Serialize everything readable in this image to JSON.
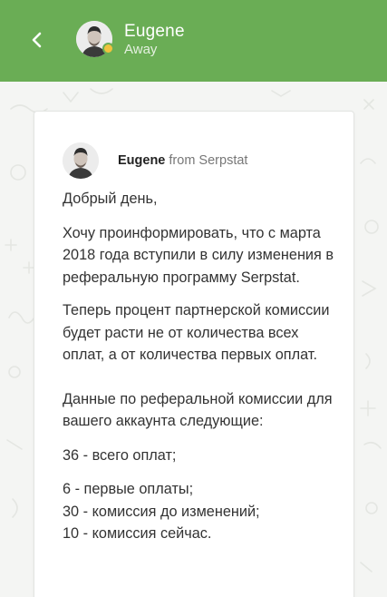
{
  "header": {
    "contact_name": "Eugene",
    "contact_status": "Away",
    "status_color": "#f1c33e",
    "brand_color": "#6aad55"
  },
  "message": {
    "sender_name": "Eugene",
    "sender_org": "from Serpstat",
    "paragraphs": [
      "Добрый день,",
      "Хочу проинформировать, что с марта 2018 года вступили в силу изменения в реферальную программу Serpstat.",
      "Теперь процент партнерской комиссии будет расти не от количества всех оплат, а от количества первых оплат.",
      "Данные по реферальной комиссии для вашего аккаунта следующие:",
      " 36 - всего оплат;",
      "6 - первые оплаты;\n 30 - комиссия до изменений;\n 10 - комиссия сейчас."
    ]
  }
}
